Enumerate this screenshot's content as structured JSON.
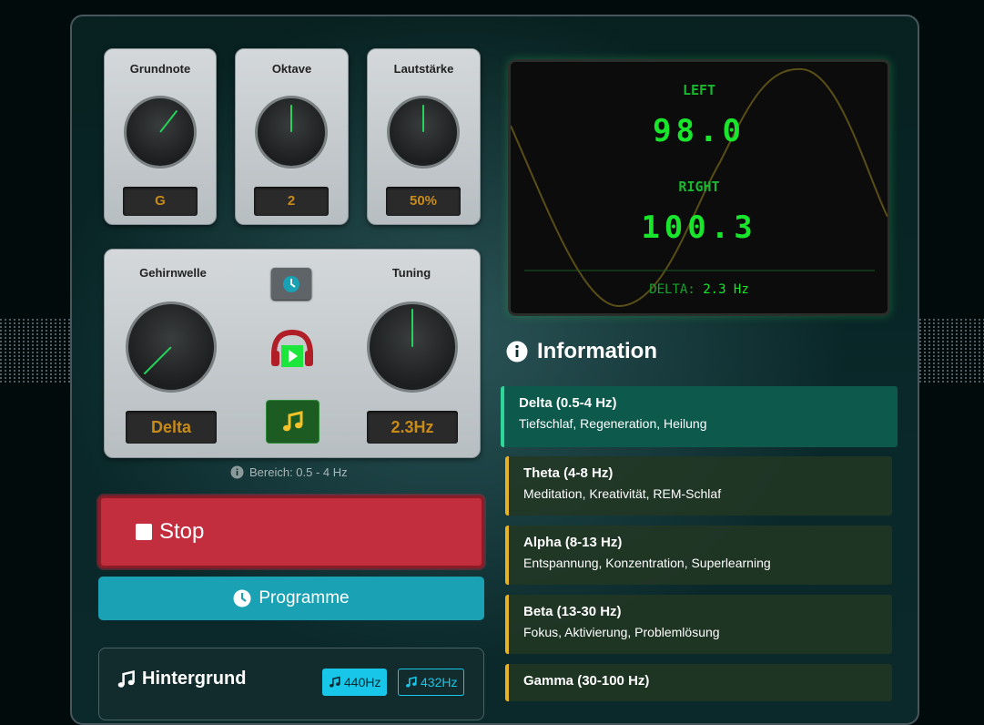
{
  "knobs": {
    "grundnote": {
      "title": "Grundnote",
      "value": "G"
    },
    "oktave": {
      "title": "Oktave",
      "value": "2"
    },
    "lautstaerke": {
      "title": "Lautstärke",
      "value": "50%"
    },
    "gehirnwelle": {
      "title": "Gehirnwelle",
      "value": "Delta"
    },
    "tuning": {
      "title": "Tuning",
      "value": "2.3Hz"
    }
  },
  "range_hint": "Bereich: 0.5 - 4 Hz",
  "scope": {
    "left_label": "LEFT",
    "left_value": "98.0",
    "right_label": "RIGHT",
    "right_value": "100.3",
    "delta_label": "DELTA:",
    "delta_value": "2.3 Hz"
  },
  "buttons": {
    "stop": "Stop",
    "programme": "Programme"
  },
  "information": {
    "title": "Information",
    "items": [
      {
        "title": "Delta (0.5-4 Hz)",
        "desc": "Tiefschlaf, Regeneration, Heilung"
      },
      {
        "title": "Theta (4-8 Hz)",
        "desc": "Meditation, Kreativität, REM-Schlaf"
      },
      {
        "title": "Alpha (8-13 Hz)",
        "desc": "Entspannung, Konzentration, Superlearning"
      },
      {
        "title": "Beta (13-30 Hz)",
        "desc": "Fokus, Aktivierung, Problemlösung"
      },
      {
        "title": "Gamma (30-100 Hz)",
        "desc": ""
      }
    ]
  },
  "hintergrund": {
    "title": "Hintergrund",
    "hz440": "440Hz",
    "hz432": "432Hz"
  },
  "colors": {
    "accent_green": "#19e52c",
    "stop_red": "#c22e3e",
    "teal": "#1aa2b4",
    "card_yellow": "#e7b325"
  }
}
